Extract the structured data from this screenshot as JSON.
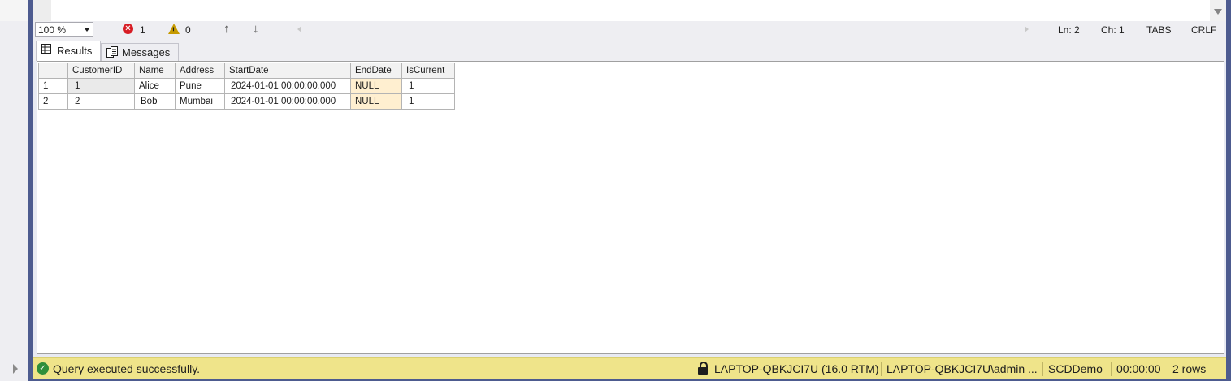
{
  "editor_status": {
    "zoom": "100 %",
    "error_count": "1",
    "warning_count": "0",
    "nav_up": "↑",
    "nav_down": "↓",
    "line": "Ln: 2",
    "char": "Ch: 1",
    "indent": "TABS",
    "line_endings": "CRLF"
  },
  "tabs": {
    "results": "Results",
    "messages": "Messages"
  },
  "grid": {
    "columns": [
      "",
      "CustomerID",
      "Name",
      "Address",
      "StartDate",
      "EndDate",
      "IsCurrent"
    ],
    "rows": [
      [
        "1",
        "1",
        "Alice",
        "Pune",
        "2024-01-01 00:00:00.000",
        "NULL",
        "1"
      ],
      [
        "2",
        "2",
        "Bob",
        "Mumbai",
        "2024-01-01 00:00:00.000",
        "NULL",
        "1"
      ]
    ]
  },
  "statusbar": {
    "message": "Query executed successfully.",
    "server": "LAPTOP-QBKJCI7U (16.0 RTM)",
    "user": "LAPTOP-QBKJCI7U\\admin ...",
    "database": "SCDDemo",
    "elapsed": "00:00:00",
    "row_count": "2 rows"
  },
  "colors": {
    "frame": "#4d5b8f",
    "statusbar_bg": "#efe48a",
    "null_cell_bg": "#ffefd0",
    "success": "#2f8f3a",
    "error": "#d71c24",
    "warning": "#c69a00"
  },
  "icons": {
    "error": "error-icon",
    "warning": "warning-icon",
    "success": "success-icon",
    "lock": "lock-icon",
    "results_tab": "grid-icon",
    "messages_tab": "messages-icon"
  }
}
